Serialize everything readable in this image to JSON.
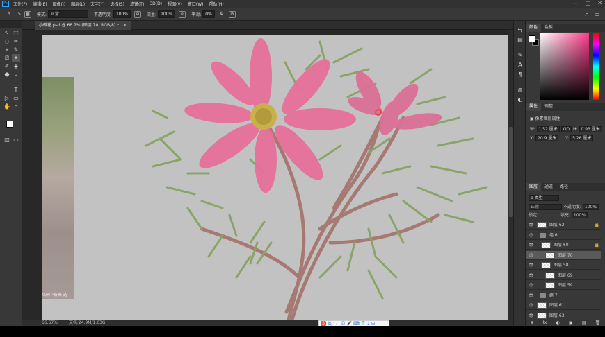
{
  "menu": {
    "items": [
      "文件(F)",
      "编辑(E)",
      "图像(I)",
      "图层(L)",
      "文字(Y)",
      "选择(S)",
      "滤镜(T)",
      "3D(D)",
      "视图(V)",
      "窗口(W)",
      "帮助(H)"
    ]
  },
  "window_controls": [
    "—",
    "□",
    "✕"
  ],
  "options": {
    "mode_label": "模式:",
    "mode_value": "正常",
    "opacity_label": "不透明度:",
    "opacity_value": "100%",
    "flow_label": "流量:",
    "flow_value": "100%",
    "smooth_label": "平滑:",
    "smooth_value": "0%",
    "brush_size": "5"
  },
  "document": {
    "tab_title": "小碎花.psd @ 66.7% (图层 70, RGB/8) *",
    "close": "×",
    "zoom": "66.67%",
    "doc_info": "文档:24.9M/1.03G",
    "ref_caption": "0开中赛来 选"
  },
  "tools": [
    "↖",
    "⬚",
    "◌",
    "✂",
    "⌖",
    "✎",
    "⎚",
    "✦",
    "✐",
    "◈",
    "⬣",
    "⌕",
    "T",
    "▷",
    "▭",
    "✋",
    "⌕"
  ],
  "side_icons": [
    "⇆",
    "▤",
    "✎",
    "A",
    "¶",
    "◍",
    "◐"
  ],
  "color_panel": {
    "tabs": [
      "颜色",
      "色板"
    ],
    "fg": "#ffffff",
    "bg": "#000000"
  },
  "properties": {
    "tabs": [
      "属性",
      "调整"
    ],
    "title": "像素图层属性",
    "w_label": "W:",
    "w_value": "1.52 厘米",
    "link": "GO",
    "h_label": "H:",
    "h_value": "0.93 厘米",
    "x_label": "X:",
    "x_value": "20.9 厘米",
    "y_label": "Y:",
    "y_value": "5.26 厘米"
  },
  "layers": {
    "tabs": [
      "图层",
      "通道",
      "路径"
    ],
    "filter": "ρ 类型",
    "blend": "正常",
    "opacity_label": "不透明度:",
    "opacity_value": "100%",
    "lock_label": "锁定:",
    "fill_label": "填充:",
    "fill_value": "100%",
    "rows": [
      {
        "name": "图层 62",
        "kind": "layer",
        "locked": true,
        "indent": 0
      },
      {
        "name": "组 6",
        "kind": "group",
        "locked": false,
        "indent": 0
      },
      {
        "name": "图层 60",
        "kind": "layer",
        "locked": true,
        "indent": 1
      },
      {
        "name": "图层 70",
        "kind": "layer",
        "locked": false,
        "indent": 2,
        "selected": true
      },
      {
        "name": "图层 58",
        "kind": "layer",
        "locked": false,
        "indent": 1
      },
      {
        "name": "图层 69",
        "kind": "layer",
        "locked": false,
        "indent": 2
      },
      {
        "name": "图层 59",
        "kind": "layer",
        "locked": false,
        "indent": 2
      },
      {
        "name": "组 7",
        "kind": "group",
        "locked": false,
        "indent": 0
      },
      {
        "name": "图层 61",
        "kind": "layer",
        "locked": false,
        "indent": 0
      },
      {
        "name": "图层 63",
        "kind": "layer",
        "locked": false,
        "indent": 0
      }
    ],
    "footer": [
      "⊕",
      "fx",
      "◐",
      "▣",
      "▤",
      "🗑"
    ]
  },
  "ime": {
    "logo": "S",
    "items": [
      "英",
      "·",
      "◡",
      "☺",
      "🎤",
      "⌨",
      "👕",
      "♪",
      "⊞"
    ]
  }
}
